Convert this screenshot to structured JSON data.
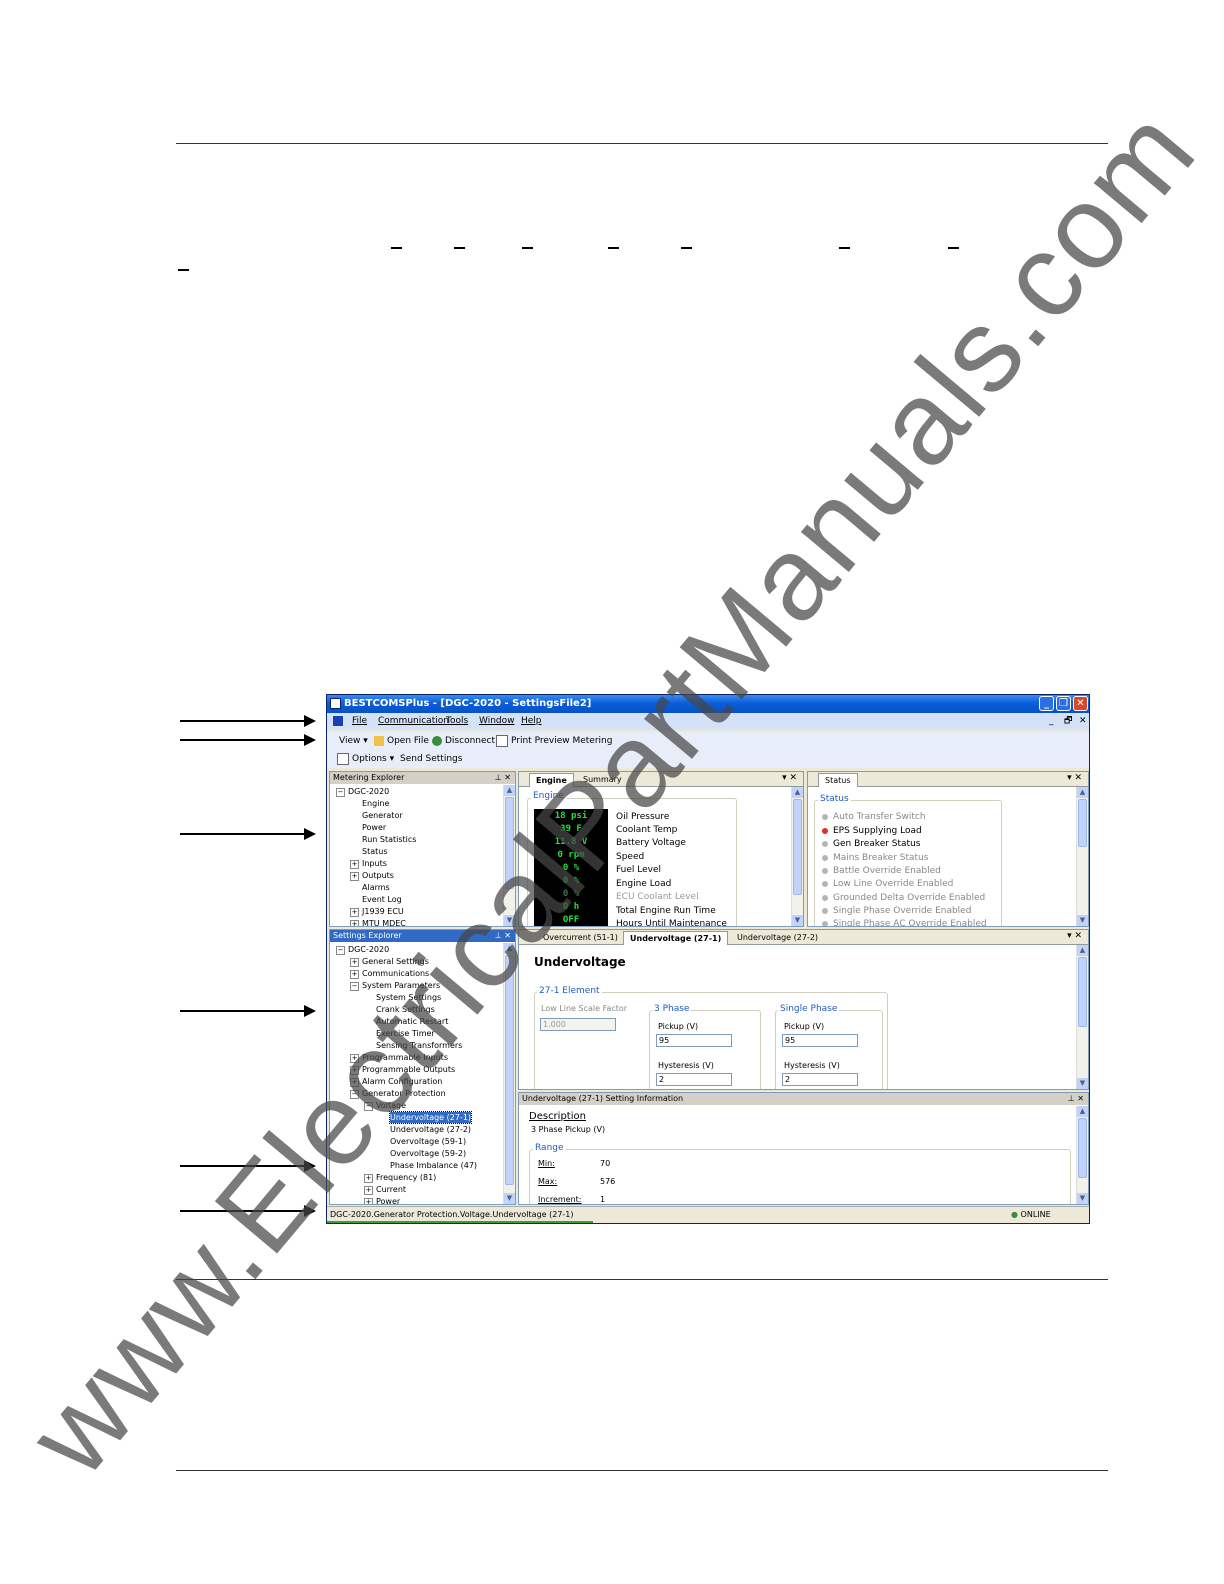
{
  "window": {
    "title": "BESTCOMSPlus - [DGC-2020 - SettingsFile2]",
    "controls": {
      "minimize": "_",
      "restore": "❐",
      "close": "✕"
    }
  },
  "menu": [
    "File",
    "Communication",
    "Tools",
    "Window",
    "Help"
  ],
  "mdi_controls": {
    "minimize": "_",
    "restore": "🗗",
    "close": "✕"
  },
  "toolbar1": {
    "view": "View",
    "open_file": "Open File",
    "disconnect": "Disconnect",
    "print_preview": "Print Preview Metering"
  },
  "toolbar2": {
    "options": "Options",
    "send_settings": "Send Settings"
  },
  "metering_explorer": {
    "title": "Metering Explorer",
    "root": "DGC-2020",
    "items": [
      "Engine",
      "Generator",
      "Power",
      "Run Statistics",
      "Status",
      "Inputs",
      "Outputs",
      "Alarms",
      "Event Log",
      "J1939 ECU",
      "MTU MDEC"
    ]
  },
  "settings_explorer": {
    "title": "Settings Explorer",
    "root": "DGC-2020",
    "items": [
      "General Settings",
      "Communications",
      "System Parameters",
      "System Settings",
      "Crank Settings",
      "Automatic Restart",
      "Exercise Timer",
      "Sensing Transformers",
      "Programmable Inputs",
      "Programmable Outputs",
      "Alarm Configuration",
      "Generator Protection",
      "Voltage",
      "Undervoltage (27-1)",
      "Undervoltage (27-2)",
      "Overvoltage (59-1)",
      "Overvoltage (59-2)",
      "Phase Imbalance (47)",
      "Frequency (81)",
      "Current",
      "Power"
    ]
  },
  "engine_panel": {
    "tabs": [
      "Engine",
      "Summary"
    ],
    "group": "Engine",
    "readings": [
      "18 psi",
      "39 F",
      "11.8 V",
      "0 rpm",
      "0 %",
      "0 %",
      "0 %",
      "0 h",
      "OFF"
    ],
    "labels": [
      "Oil Pressure",
      "Coolant Temp",
      "Battery Voltage",
      "Speed",
      "Fuel Level",
      "Engine Load",
      "ECU Coolant Level",
      "Total Engine Run Time",
      "Hours Until Maintenance"
    ]
  },
  "status_panel": {
    "tab": "Status",
    "group": "Status",
    "items": [
      "Auto Transfer Switch",
      "EPS Supplying Load",
      "Gen Breaker Status",
      "Mains Breaker Status",
      "Battle Override Enabled",
      "Low Line Override Enabled",
      "Grounded Delta Override Enabled",
      "Single Phase Override Enabled",
      "Single Phase AC Override Enabled"
    ],
    "colors": {
      "active": "#e03020",
      "inactive": "#b5b5b5"
    }
  },
  "protection_panel": {
    "tabs": [
      "Overcurrent (51-1)",
      "Undervoltage (27-1)",
      "Undervoltage (27-2)"
    ],
    "heading": "Undervoltage",
    "element_group": "27-1 Element",
    "low_line_label": "Low Line Scale Factor",
    "low_line_value": "1.000",
    "three_phase": {
      "title": "3 Phase",
      "pickup_label": "Pickup (V)",
      "pickup_value": "95",
      "hysteresis_label": "Hysteresis (V)",
      "hysteresis_value": "2"
    },
    "single_phase": {
      "title": "Single Phase",
      "pickup_label": "Pickup (V)",
      "pickup_value": "95",
      "hysteresis_label": "Hysteresis (V)",
      "hysteresis_value": "2"
    }
  },
  "info_panel": {
    "title": "Undervoltage (27-1) Setting Information",
    "description_heading": "Description",
    "description": "3 Phase Pickup (V)",
    "range_heading": "Range",
    "min_label": "Min:",
    "min": "70",
    "max_label": "Max:",
    "max": "576",
    "inc_label": "Increment:",
    "inc": "1"
  },
  "statusbar": {
    "path": "DGC-2020.Generator Protection.Voltage.Undervoltage (27-1)",
    "connection": "ONLINE"
  },
  "watermark": "www.ElectricalPartManuals.com"
}
